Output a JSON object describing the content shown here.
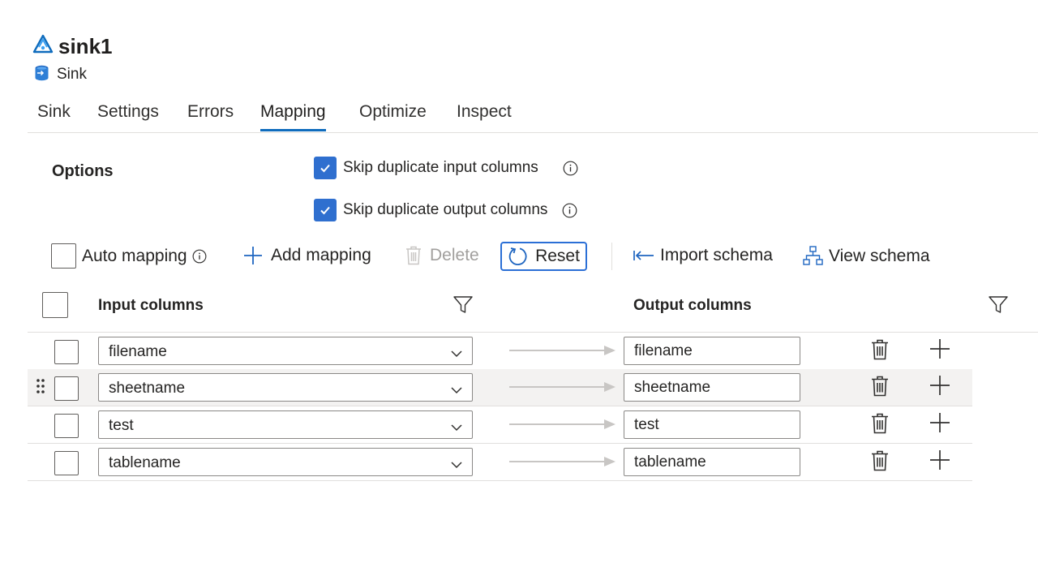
{
  "header": {
    "title": "sink1",
    "subtitle": "Sink",
    "brand_color": "#0f6cbd"
  },
  "tabs": [
    {
      "label": "Sink",
      "active": false
    },
    {
      "label": "Settings",
      "active": false
    },
    {
      "label": "Errors",
      "active": false
    },
    {
      "label": "Mapping",
      "active": true
    },
    {
      "label": "Optimize",
      "active": false
    },
    {
      "label": "Inspect",
      "active": false
    }
  ],
  "options": {
    "label": "Options",
    "skip_input": {
      "label": "Skip duplicate input columns",
      "checked": true
    },
    "skip_output": {
      "label": "Skip duplicate output columns",
      "checked": true
    }
  },
  "toolbar": {
    "auto_mapping": {
      "label": "Auto mapping",
      "checked": false
    },
    "add_mapping": "Add mapping",
    "delete": "Delete",
    "reset": "Reset",
    "import_schema": "Import schema",
    "view_schema": "View schema"
  },
  "grid": {
    "input_header": "Input columns",
    "output_header": "Output columns",
    "rows": [
      {
        "input": "filename",
        "output": "filename"
      },
      {
        "input": "sheetname",
        "output": "sheetname"
      },
      {
        "input": "test",
        "output": "test"
      },
      {
        "input": "tablename",
        "output": "tablename"
      }
    ]
  },
  "icons": {
    "title_icon": "data-flow-icon",
    "subtitle_icon": "sink-database-icon",
    "info": "info-icon",
    "add": "plus-icon",
    "delete": "trash-icon",
    "reset": "refresh-icon",
    "import": "import-arrow-icon",
    "view": "hierarchy-icon",
    "filter": "filter-icon",
    "dropdown": "chevron-down-icon",
    "mapping_arrow": "right-arrow-icon",
    "drag": "drag-handle-icon"
  }
}
